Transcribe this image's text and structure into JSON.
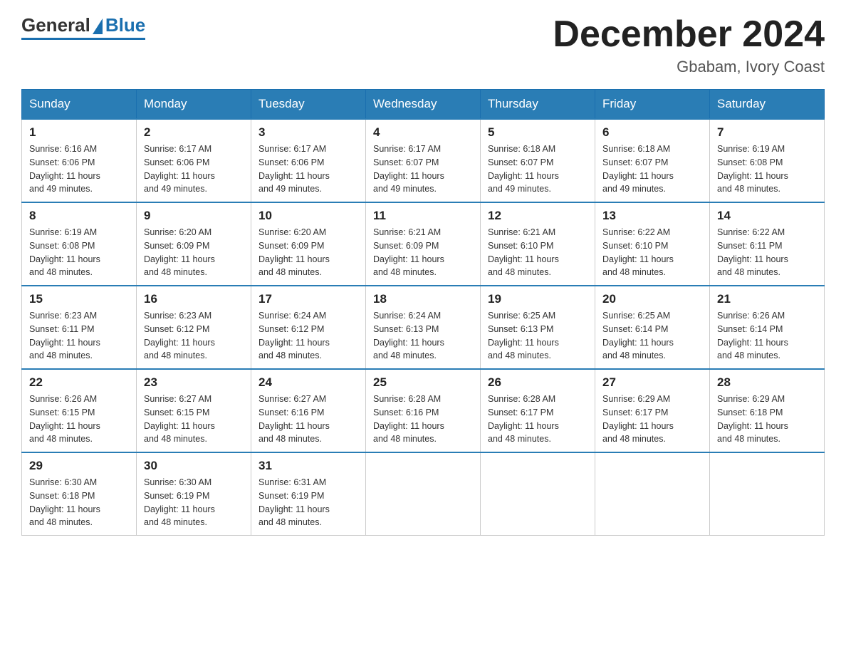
{
  "logo": {
    "general": "General",
    "blue": "Blue"
  },
  "title": "December 2024",
  "location": "Gbabam, Ivory Coast",
  "days_of_week": [
    "Sunday",
    "Monday",
    "Tuesday",
    "Wednesday",
    "Thursday",
    "Friday",
    "Saturday"
  ],
  "weeks": [
    [
      {
        "day": "1",
        "sunrise": "6:16 AM",
        "sunset": "6:06 PM",
        "daylight": "11 hours and 49 minutes."
      },
      {
        "day": "2",
        "sunrise": "6:17 AM",
        "sunset": "6:06 PM",
        "daylight": "11 hours and 49 minutes."
      },
      {
        "day": "3",
        "sunrise": "6:17 AM",
        "sunset": "6:06 PM",
        "daylight": "11 hours and 49 minutes."
      },
      {
        "day": "4",
        "sunrise": "6:17 AM",
        "sunset": "6:07 PM",
        "daylight": "11 hours and 49 minutes."
      },
      {
        "day": "5",
        "sunrise": "6:18 AM",
        "sunset": "6:07 PM",
        "daylight": "11 hours and 49 minutes."
      },
      {
        "day": "6",
        "sunrise": "6:18 AM",
        "sunset": "6:07 PM",
        "daylight": "11 hours and 49 minutes."
      },
      {
        "day": "7",
        "sunrise": "6:19 AM",
        "sunset": "6:08 PM",
        "daylight": "11 hours and 48 minutes."
      }
    ],
    [
      {
        "day": "8",
        "sunrise": "6:19 AM",
        "sunset": "6:08 PM",
        "daylight": "11 hours and 48 minutes."
      },
      {
        "day": "9",
        "sunrise": "6:20 AM",
        "sunset": "6:09 PM",
        "daylight": "11 hours and 48 minutes."
      },
      {
        "day": "10",
        "sunrise": "6:20 AM",
        "sunset": "6:09 PM",
        "daylight": "11 hours and 48 minutes."
      },
      {
        "day": "11",
        "sunrise": "6:21 AM",
        "sunset": "6:09 PM",
        "daylight": "11 hours and 48 minutes."
      },
      {
        "day": "12",
        "sunrise": "6:21 AM",
        "sunset": "6:10 PM",
        "daylight": "11 hours and 48 minutes."
      },
      {
        "day": "13",
        "sunrise": "6:22 AM",
        "sunset": "6:10 PM",
        "daylight": "11 hours and 48 minutes."
      },
      {
        "day": "14",
        "sunrise": "6:22 AM",
        "sunset": "6:11 PM",
        "daylight": "11 hours and 48 minutes."
      }
    ],
    [
      {
        "day": "15",
        "sunrise": "6:23 AM",
        "sunset": "6:11 PM",
        "daylight": "11 hours and 48 minutes."
      },
      {
        "day": "16",
        "sunrise": "6:23 AM",
        "sunset": "6:12 PM",
        "daylight": "11 hours and 48 minutes."
      },
      {
        "day": "17",
        "sunrise": "6:24 AM",
        "sunset": "6:12 PM",
        "daylight": "11 hours and 48 minutes."
      },
      {
        "day": "18",
        "sunrise": "6:24 AM",
        "sunset": "6:13 PM",
        "daylight": "11 hours and 48 minutes."
      },
      {
        "day": "19",
        "sunrise": "6:25 AM",
        "sunset": "6:13 PM",
        "daylight": "11 hours and 48 minutes."
      },
      {
        "day": "20",
        "sunrise": "6:25 AM",
        "sunset": "6:14 PM",
        "daylight": "11 hours and 48 minutes."
      },
      {
        "day": "21",
        "sunrise": "6:26 AM",
        "sunset": "6:14 PM",
        "daylight": "11 hours and 48 minutes."
      }
    ],
    [
      {
        "day": "22",
        "sunrise": "6:26 AM",
        "sunset": "6:15 PM",
        "daylight": "11 hours and 48 minutes."
      },
      {
        "day": "23",
        "sunrise": "6:27 AM",
        "sunset": "6:15 PM",
        "daylight": "11 hours and 48 minutes."
      },
      {
        "day": "24",
        "sunrise": "6:27 AM",
        "sunset": "6:16 PM",
        "daylight": "11 hours and 48 minutes."
      },
      {
        "day": "25",
        "sunrise": "6:28 AM",
        "sunset": "6:16 PM",
        "daylight": "11 hours and 48 minutes."
      },
      {
        "day": "26",
        "sunrise": "6:28 AM",
        "sunset": "6:17 PM",
        "daylight": "11 hours and 48 minutes."
      },
      {
        "day": "27",
        "sunrise": "6:29 AM",
        "sunset": "6:17 PM",
        "daylight": "11 hours and 48 minutes."
      },
      {
        "day": "28",
        "sunrise": "6:29 AM",
        "sunset": "6:18 PM",
        "daylight": "11 hours and 48 minutes."
      }
    ],
    [
      {
        "day": "29",
        "sunrise": "6:30 AM",
        "sunset": "6:18 PM",
        "daylight": "11 hours and 48 minutes."
      },
      {
        "day": "30",
        "sunrise": "6:30 AM",
        "sunset": "6:19 PM",
        "daylight": "11 hours and 48 minutes."
      },
      {
        "day": "31",
        "sunrise": "6:31 AM",
        "sunset": "6:19 PM",
        "daylight": "11 hours and 48 minutes."
      },
      null,
      null,
      null,
      null
    ]
  ],
  "labels": {
    "sunrise": "Sunrise:",
    "sunset": "Sunset:",
    "daylight": "Daylight:"
  }
}
